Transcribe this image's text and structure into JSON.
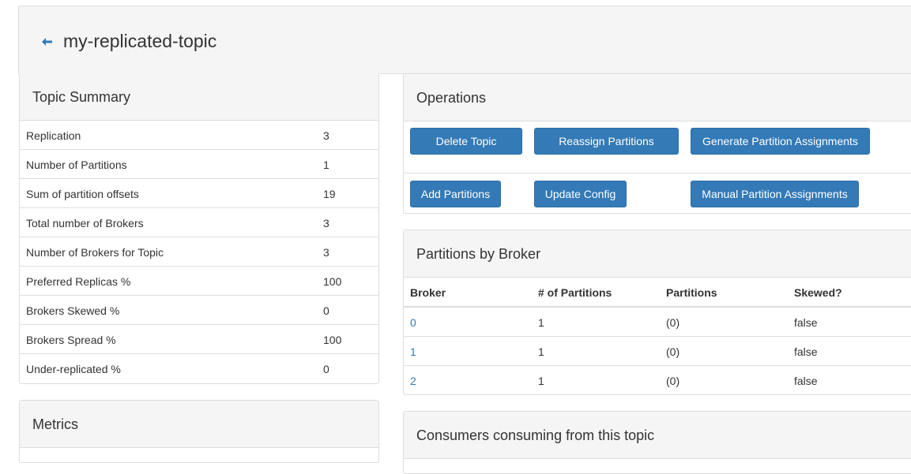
{
  "header": {
    "title": "my-replicated-topic",
    "back_icon": "arrow-left-icon"
  },
  "summary": {
    "heading": "Topic Summary",
    "rows": [
      {
        "label": "Replication",
        "value": "3"
      },
      {
        "label": "Number of Partitions",
        "value": "1"
      },
      {
        "label": "Sum of partition offsets",
        "value": "19"
      },
      {
        "label": "Total number of Brokers",
        "value": "3"
      },
      {
        "label": "Number of Brokers for Topic",
        "value": "3"
      },
      {
        "label": "Preferred Replicas %",
        "value": "100"
      },
      {
        "label": "Brokers Skewed %",
        "value": "0"
      },
      {
        "label": "Brokers Spread %",
        "value": "100"
      },
      {
        "label": "Under-replicated %",
        "value": "0"
      }
    ]
  },
  "metrics": {
    "heading": "Metrics"
  },
  "operations": {
    "heading": "Operations",
    "delete_topic": "Delete Topic",
    "reassign_partitions": "Reassign Partitions",
    "generate_assignments": "Generate Partition Assignments",
    "add_partitions": "Add Partitions",
    "update_config": "Update Config",
    "manual_assignments": "Manual Partition Assignments",
    "button_color": "#337ab7"
  },
  "partitions_by_broker": {
    "heading": "Partitions by Broker",
    "columns": [
      "Broker",
      "# of Partitions",
      "Partitions",
      "Skewed?"
    ],
    "rows": [
      {
        "broker": "0",
        "count": "1",
        "partitions": "(0)",
        "skewed": "false"
      },
      {
        "broker": "1",
        "count": "1",
        "partitions": "(0)",
        "skewed": "false"
      },
      {
        "broker": "2",
        "count": "1",
        "partitions": "(0)",
        "skewed": "false"
      }
    ]
  },
  "consumers": {
    "heading": "Consumers consuming from this topic"
  }
}
